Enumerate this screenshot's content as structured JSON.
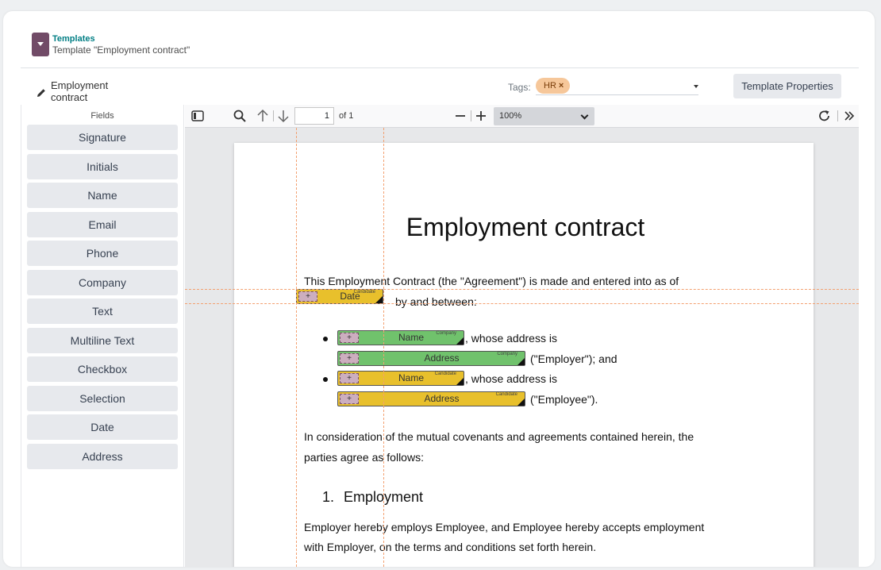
{
  "header": {
    "breadcrumb_parent": "Templates",
    "breadcrumb_current": "Template \"Employment contract\""
  },
  "template": {
    "name": "Employment contract",
    "tags_label": "Tags:",
    "tag": "HR",
    "tag_remove": "×",
    "properties_button": "Template Properties"
  },
  "sidebar": {
    "title": "Fields",
    "items": [
      "Signature",
      "Initials",
      "Name",
      "Email",
      "Phone",
      "Company",
      "Text",
      "Multiline Text",
      "Checkbox",
      "Selection",
      "Date",
      "Address"
    ]
  },
  "viewer": {
    "page_number": "1",
    "page_count_label": "of 1",
    "zoom": "100%"
  },
  "document": {
    "title": "Employment contract",
    "intro_line1": "This Employment Contract (the \"Agreement\") is made and entered into as of",
    "intro_line2": "by and between:",
    "bullet1_suffix": ", whose address is",
    "bullet1_line2_suffix": "(\"Employer\"); and",
    "bullet2_suffix": ", whose address is",
    "bullet2_line2_suffix": "(\"Employee\").",
    "consideration_line1": "In consideration of the mutual covenants and agreements contained herein, the",
    "consideration_line2": "parties agree as follows:",
    "section_number": "1.",
    "section_title": "Employment",
    "employment_line1": "Employer hereby employs Employee, and Employee hereby accepts employment",
    "employment_line2": "with Employer, on the terms and conditions set forth herein."
  },
  "fields": {
    "date": {
      "label": "Date",
      "role": "Candidate",
      "color": "#e8c02c"
    },
    "employer_name": {
      "label": "Name",
      "role": "Company",
      "color": "#70c26c"
    },
    "employer_address": {
      "label": "Address",
      "role": "Company",
      "color": "#70c26c"
    },
    "employee_name": {
      "label": "Name",
      "role": "Candidate",
      "color": "#e8c02c"
    },
    "employee_address": {
      "label": "Address",
      "role": "Candidate",
      "color": "#e8c02c"
    },
    "grip": "+"
  },
  "colors": {
    "brand": "#714b67",
    "link": "#017e84",
    "tag_bg": "#f6c79a",
    "guide": "#f3a070"
  }
}
